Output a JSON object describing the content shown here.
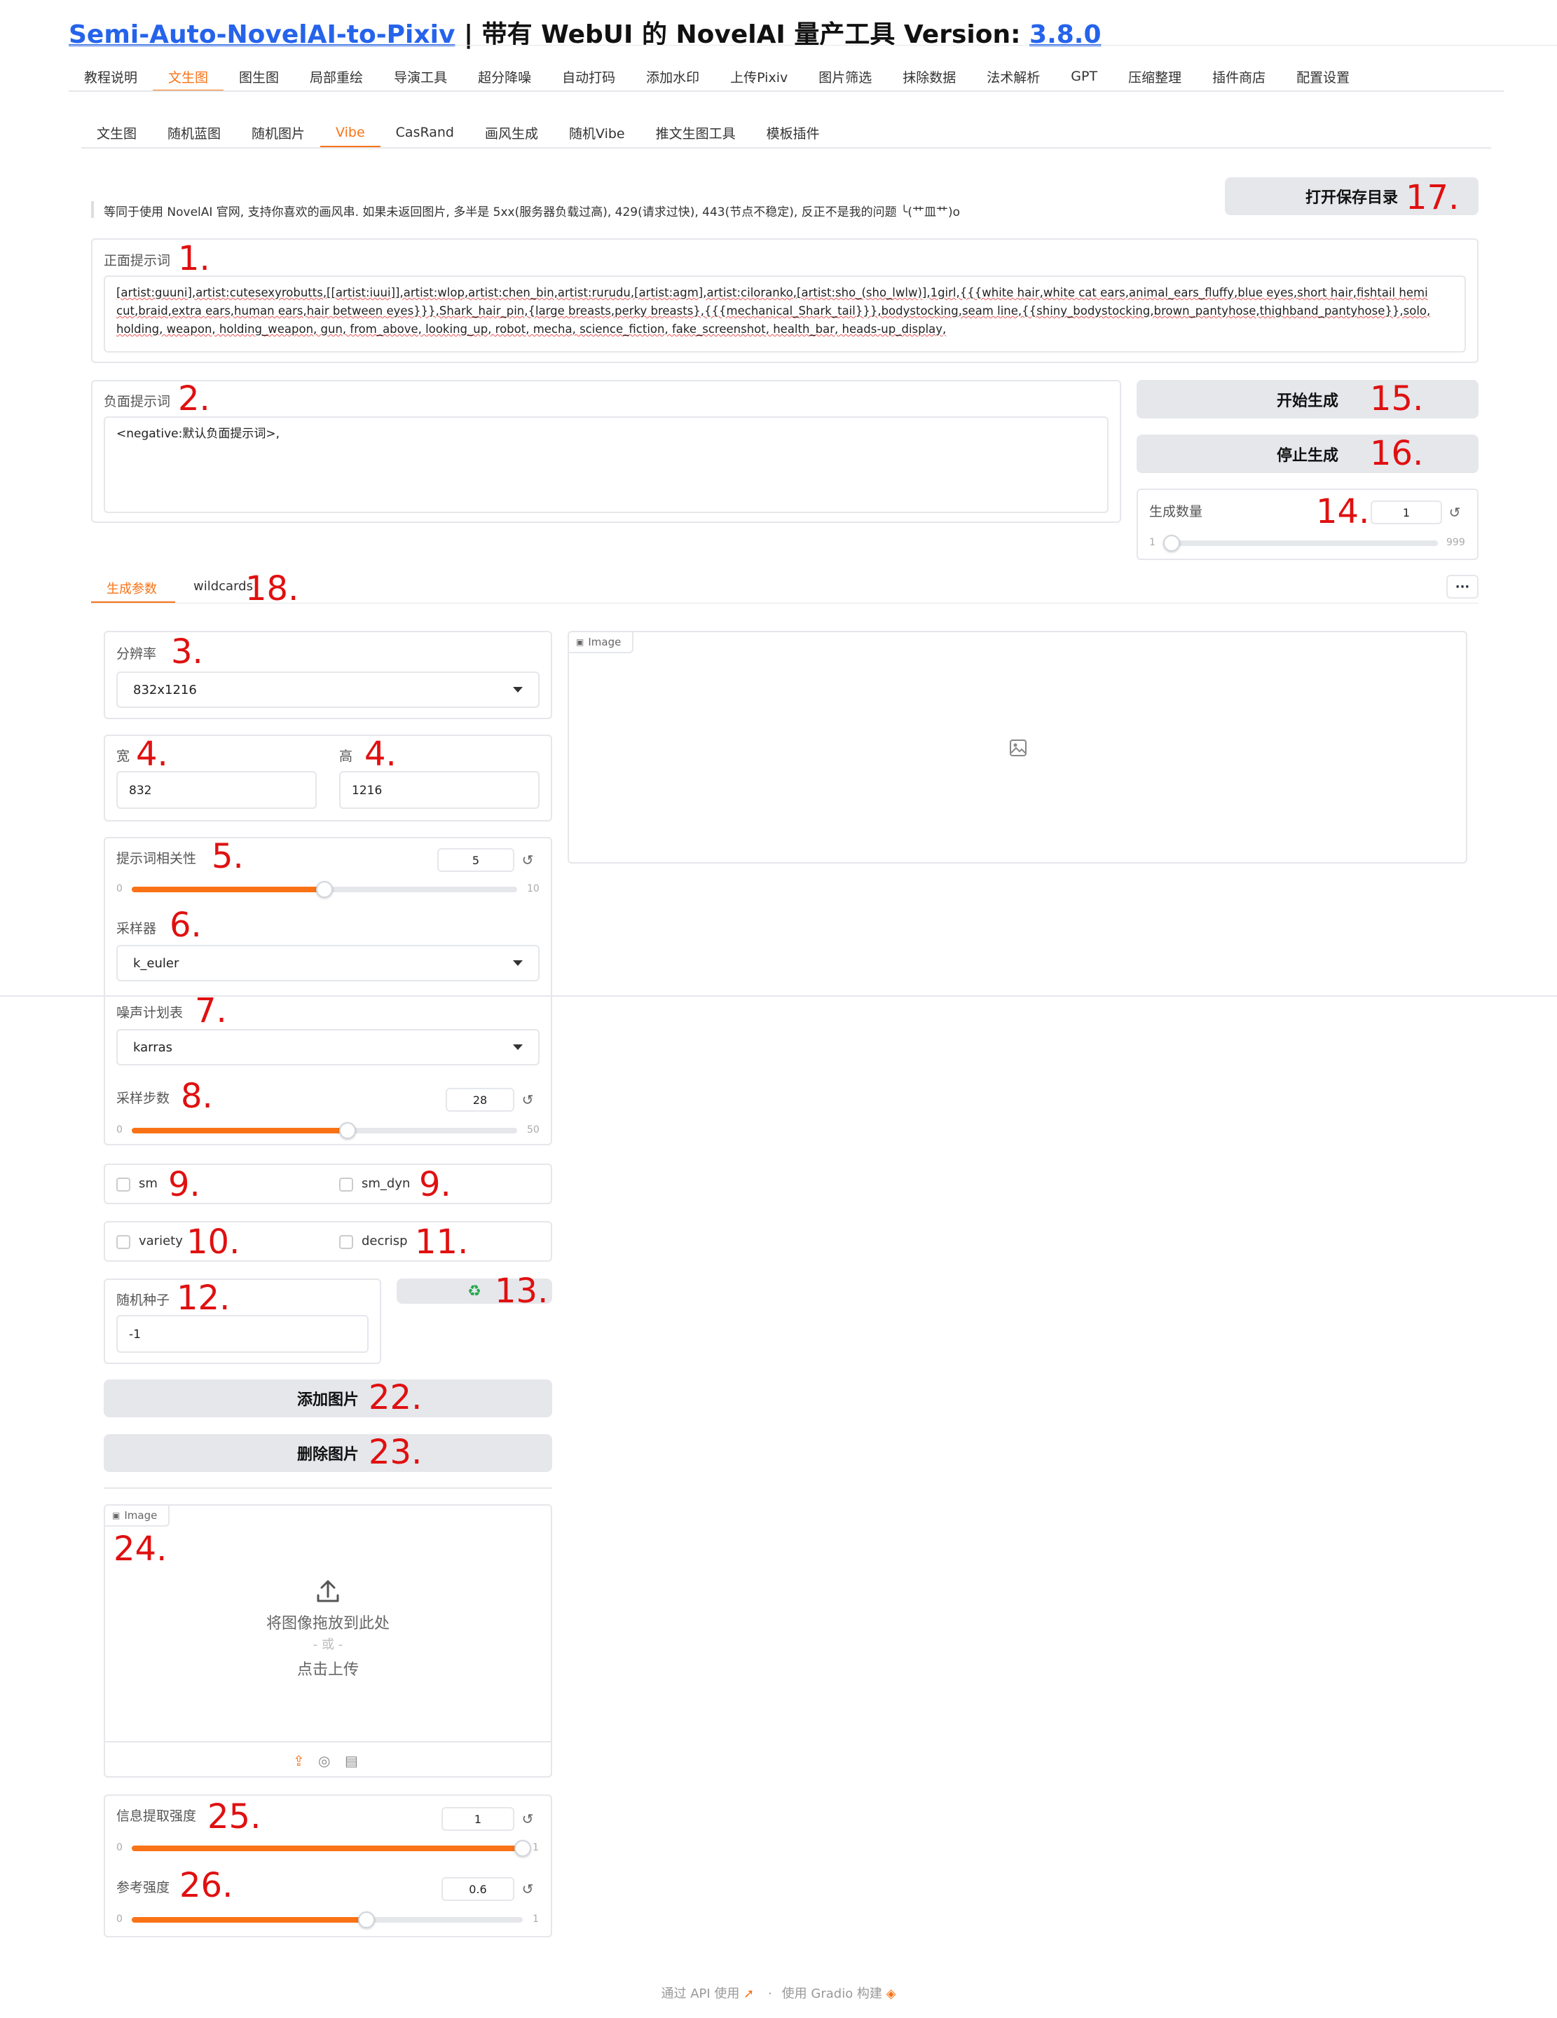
{
  "header": {
    "link_name": "Semi-Auto-NovelAI-to-Pixiv",
    "rest": " | 带有 WebUI 的 NovelAI 量产工具 Version: ",
    "version": "3.8.0"
  },
  "main_tabs": [
    "教程说明",
    "文生图",
    "图生图",
    "局部重绘",
    "导演工具",
    "超分降噪",
    "自动打码",
    "添加水印",
    "上传Pixiv",
    "图片筛选",
    "抹除数据",
    "法术解析",
    "GPT",
    "压缩整理",
    "插件商店",
    "配置设置"
  ],
  "sub_tabs": [
    "文生图",
    "随机蓝图",
    "随机图片",
    "Vibe",
    "CasRand",
    "画风生成",
    "随机Vibe",
    "推文生图工具",
    "模板插件"
  ],
  "notice": "等同于使用 NovelAI 官网, 支持你喜欢的画风串. 如果未返回图片, 多半是 5xx(服务器负载过高), 429(请求过快), 443(节点不稳定), 反正不是我的问题 ╰(艹皿艹)o",
  "open_dir_label": "打开保存目录",
  "positive": {
    "label": "正面提示词",
    "value": "[artist:guuni],artist:cutesexyrobutts,[[artist:iuui]],artist:wlop,artist:chen_bin,artist:rurudu,[artist:agm],artist:ciloranko,[artist:sho_(sho_lwlw)],1girl,{{{white hair,white cat ears,animal_ears_fluffy,blue eyes,short hair,fishtail hemi cut,braid,extra ears,human ears,hair between eyes}}},Shark_hair_pin,{large breasts,perky breasts},{{{mechanical_Shark_tail}}},bodystocking,seam line,{{shiny_bodystocking,brown_pantyhose,thighband_pantyhose}},solo, holding, weapon, holding_weapon, gun, from_above, looking_up, robot, mecha, science_fiction, fake_screenshot, health_bar, heads-up_display,"
  },
  "negative": {
    "label": "负面提示词",
    "value": "<negative:默认负面提示词>,"
  },
  "start_label": "开始生成",
  "stop_label": "停止生成",
  "count": {
    "label": "生成数量",
    "value": "1",
    "min": "1",
    "max": "999",
    "fraction": 0
  },
  "param_tabs": [
    "生成参数",
    "wildcards"
  ],
  "more_icon": "···",
  "resolution": {
    "label": "分辨率",
    "value": "832x1216"
  },
  "width": {
    "label": "宽",
    "value": "832"
  },
  "height": {
    "label": "高",
    "value": "1216"
  },
  "scale": {
    "label": "提示词相关性",
    "value": "5",
    "min": "0",
    "max": "10",
    "fraction": 0.5
  },
  "sampler": {
    "label": "采样器",
    "value": "k_euler"
  },
  "noise": {
    "label": "噪声计划表",
    "value": "karras"
  },
  "steps": {
    "label": "采样步数",
    "value": "28",
    "min": "0",
    "max": "50",
    "fraction": 0.56
  },
  "sm_label": "sm",
  "sm_dyn_label": "sm_dyn",
  "variety_label": "variety",
  "decrisp_label": "decrisp",
  "seed": {
    "label": "随机种子",
    "value": "-1"
  },
  "recycle_icon": "♻",
  "add_image_label": "添加图片",
  "delete_image_label": "删除图片",
  "image_label": "Image",
  "upload": {
    "drop": "将图像拖放到此处",
    "or": "- 或 -",
    "click": "点击上传"
  },
  "info_extract": {
    "label": "信息提取强度",
    "value": "1",
    "min": "0",
    "max": "1",
    "fraction": 1.0
  },
  "ref_strength": {
    "label": "参考强度",
    "value": "0.6",
    "min": "0",
    "max": "1",
    "fraction": 0.6
  },
  "footer": {
    "api": "通过 API 使用",
    "sep": "·",
    "gradio": "使用 Gradio 构建"
  },
  "annotations": {
    "n1": "1.",
    "n2": "2.",
    "n3": "3.",
    "n4a": "4.",
    "n4b": "4.",
    "n5": "5.",
    "n6": "6.",
    "n7": "7.",
    "n8": "8.",
    "n9a": "9.",
    "n9b": "9.",
    "n10": "10.",
    "n11": "11.",
    "n12": "12.",
    "n13": "13.",
    "n14": "14.",
    "n15": "15.",
    "n16": "16.",
    "n17": "17.",
    "n18": "18.",
    "n22": "22.",
    "n23": "23.",
    "n24": "24.",
    "n25": "25.",
    "n26": "26."
  },
  "colors": {
    "accent": "#f97316",
    "link": "#2563eb",
    "annotation": "#e01010",
    "button_bg": "#e5e7eb"
  }
}
